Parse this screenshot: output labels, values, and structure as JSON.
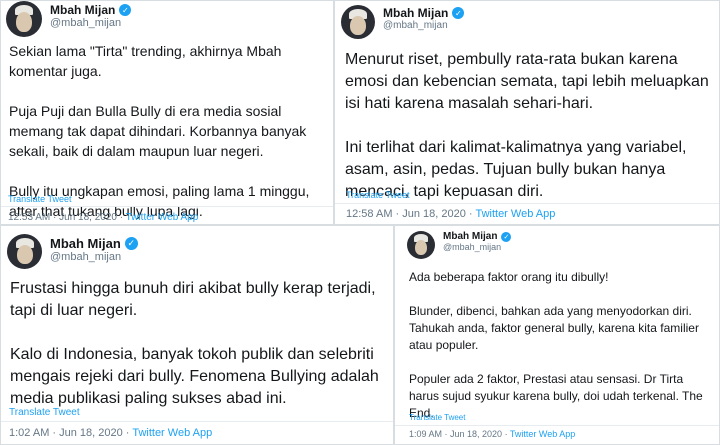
{
  "tweets": [
    {
      "display_name": "Mbah Mijan",
      "handle": "@mbah_mijan",
      "verified_icon": "verified-badge-icon",
      "text": "Sekian lama \"Tirta\" trending, akhirnya Mbah komentar juga.\n\nPuja Puji dan Bulla Bully di era media sosial memang tak dapat dihindari. Korbannya banyak sekali, baik di dalam maupun luar negeri.\n\nBully itu ungkapan emosi, paling lama 1 minggu, after that tukang bully lupa lagi.",
      "translate": "Translate Tweet",
      "timestamp": "12:53 AM · Jun 18, 2020 · ",
      "source": "Twitter Web App"
    },
    {
      "display_name": "Mbah Mijan",
      "handle": "@mbah_mijan",
      "verified_icon": "verified-badge-icon",
      "text": "Menurut riset, pembully rata-rata bukan karena emosi dan kebencian semata, tapi lebih meluapkan isi hati karena masalah sehari-hari.\n\nIni terlihat dari kalimat-kalimatnya yang variabel, asam, asin, pedas. Tujuan bully bukan  hanya mencaci, tapi kepuasan diri.",
      "translate": "Translate Tweet",
      "timestamp": "12:58 AM · Jun 18, 2020 · ",
      "source": "Twitter Web App"
    },
    {
      "display_name": "Mbah Mijan",
      "handle": "@mbah_mijan",
      "verified_icon": "verified-badge-icon",
      "text": "Frustasi hingga bunuh diri akibat bully kerap terjadi, tapi di luar negeri.\n\nKalo di Indonesia, banyak tokoh publik dan selebriti mengais rejeki dari bully. Fenomena Bullying adalah media publikasi paling sukses abad ini.",
      "translate": "Translate Tweet",
      "timestamp": "1:02 AM · Jun 18, 2020 · ",
      "source": "Twitter Web App"
    },
    {
      "display_name": "Mbah Mijan",
      "handle": "@mbah_mijan",
      "verified_icon": "verified-badge-icon",
      "text": "Ada beberapa faktor orang itu dibully!\n\nBlunder, dibenci, bahkan ada yang menyodorkan diri. Tahukah anda, faktor general bully, karena kita familier atau populer.\n\nPopuler ada 2 faktor, Prestasi atau sensasi. Dr Tirta harus sujud syukur karena bully, doi udah terkenal. The End.",
      "translate": "Translate Tweet",
      "timestamp": "1:09 AM · Jun 18, 2020 · ",
      "source": "Twitter Web App"
    }
  ]
}
